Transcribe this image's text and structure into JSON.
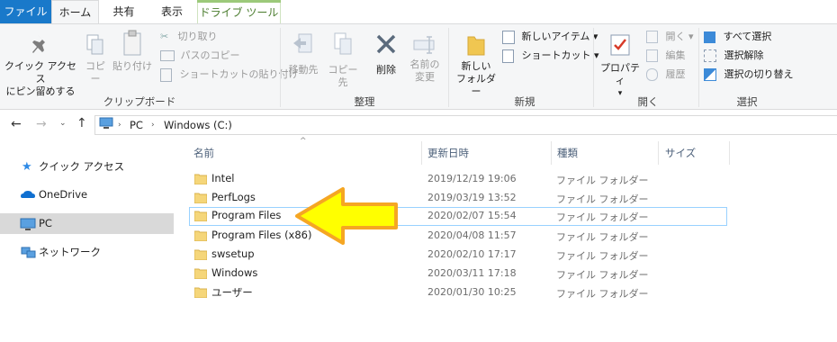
{
  "tabs": {
    "file": "ファイル",
    "home": "ホーム",
    "share": "共有",
    "view": "表示",
    "drive_tools": "ドライブ ツール"
  },
  "ribbon": {
    "clipboard": {
      "label": "クリップボード",
      "pin_line1": "クイック アクセス",
      "pin_line2": "にピン留めする",
      "copy": "コピー",
      "paste": "貼り付け",
      "cut": "切り取り",
      "copy_path": "パスのコピー",
      "paste_shortcut": "ショートカットの貼り付け"
    },
    "organize": {
      "label": "整理",
      "move_to": "移動先",
      "copy_to": "コピー先",
      "delete": "削除",
      "rename_line1": "名前の",
      "rename_line2": "変更"
    },
    "new": {
      "label": "新規",
      "new_folder_line1": "新しい",
      "new_folder_line2": "フォルダー",
      "new_item": "新しいアイテム",
      "shortcut": "ショートカット"
    },
    "open": {
      "label": "開く",
      "properties": "プロパティ",
      "open": "開く",
      "edit": "編集",
      "history": "履歴"
    },
    "select": {
      "label": "選択",
      "select_all": "すべて選択",
      "select_none": "選択解除",
      "invert": "選択の切り替え"
    }
  },
  "address": {
    "crumbs": [
      "PC",
      "Windows (C:)"
    ]
  },
  "nav": {
    "quick_access": "クイック アクセス",
    "onedrive": "OneDrive",
    "pc": "PC",
    "network": "ネットワーク"
  },
  "columns": {
    "name": "名前",
    "date": "更新日時",
    "type": "種類",
    "size": "サイズ"
  },
  "files": [
    {
      "name": "Intel",
      "date": "2019/12/19 19:06",
      "type": "ファイル フォルダー"
    },
    {
      "name": "PerfLogs",
      "date": "2019/03/19 13:52",
      "type": "ファイル フォルダー"
    },
    {
      "name": "Program Files",
      "date": "2020/02/07 15:54",
      "type": "ファイル フォルダー"
    },
    {
      "name": "Program Files (x86)",
      "date": "2020/04/08 11:57",
      "type": "ファイル フォルダー"
    },
    {
      "name": "swsetup",
      "date": "2020/02/10 17:17",
      "type": "ファイル フォルダー"
    },
    {
      "name": "Windows",
      "date": "2020/03/11 17:18",
      "type": "ファイル フォルダー"
    },
    {
      "name": "ユーザー",
      "date": "2020/01/30 10:25",
      "type": "ファイル フォルダー"
    }
  ],
  "colors": {
    "accent": "#1979ca",
    "arrow_fill": "#ffff00",
    "arrow_stroke": "#f5a623",
    "selection_border": "#99d1ff",
    "folder": "#f5d67a"
  }
}
